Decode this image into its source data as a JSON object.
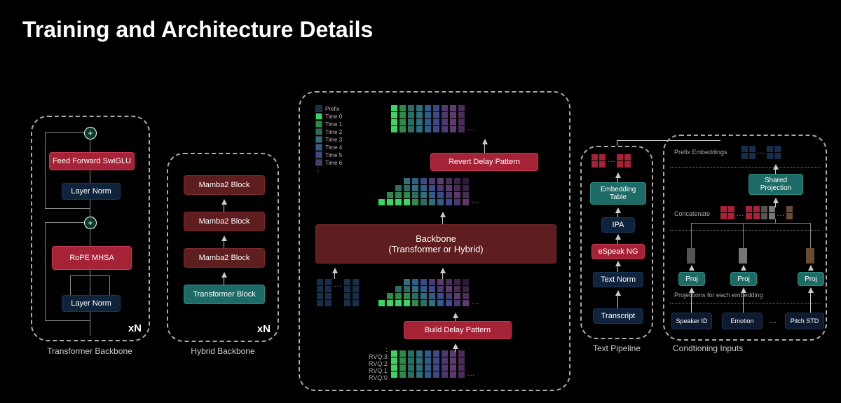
{
  "title": "Training and Architecture Details",
  "transformer_backbone": {
    "caption": "Transformer Backbone",
    "blocks": {
      "ffn": "Feed Forward SwiGLU",
      "ln1": "Layer Norm",
      "mhsa": "RoPE MHSA",
      "ln2": "Layer Norm"
    },
    "repeat": "xN"
  },
  "hybrid_backbone": {
    "caption": "Hybrid Backbone",
    "blocks": {
      "m1": "Mamba2 Block",
      "m2": "Mamba2 Block",
      "m3": "Mamba2 Block",
      "tf": "Transformer Block"
    },
    "repeat": "xN"
  },
  "center": {
    "legend": [
      "Prefix",
      "Time 0",
      "Time 1",
      "Time 2",
      "Time 3",
      "Time 4",
      "Time 5",
      "Time 6"
    ],
    "revert": "Revert Delay Pattern",
    "backbone": "Backbone\n(Transformer or Hybrid)",
    "build": "Build Delay Pattern",
    "rvq": [
      ":",
      "RVQ:3",
      "RVQ:2",
      "RVQ:1",
      "RVQ:0"
    ]
  },
  "text_pipeline": {
    "caption": "Text Pipeline",
    "blocks": {
      "embed": "Embedding Table",
      "ipa": "IPA",
      "espeak": "eSpeak NG",
      "norm": "Text Norm",
      "transcript": "Transcript"
    }
  },
  "conditioning": {
    "caption": "Condtioning Inputs",
    "prefix": "Prefix Embeddings",
    "shared": "Shared Projection",
    "concat": "Concatenate",
    "projlabel": "Projections for each embedding",
    "proj": "Proj",
    "inputs": [
      "Speaker ID",
      "Emotion",
      "Pitch STD"
    ],
    "ellipsis": "..."
  }
}
